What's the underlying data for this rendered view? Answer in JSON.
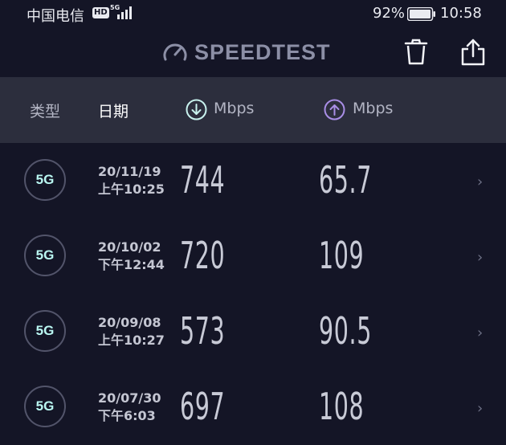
{
  "status_bar": {
    "carrier": "中国电信",
    "hd": "HD",
    "network": "5G",
    "battery": "92%",
    "time": "10:58"
  },
  "header": {
    "title": "SPEEDTEST",
    "icons": [
      "speedometer-icon",
      "trash-icon",
      "share-icon"
    ]
  },
  "columns": {
    "type": "类型",
    "date": "日期",
    "download_unit": "Mbps",
    "upload_unit": "Mbps",
    "download_color": "#c8f2ee",
    "upload_color": "#a98ee6"
  },
  "results": [
    {
      "type": "5G",
      "date": "20/11/19",
      "time": "上午10:25",
      "download": "744",
      "upload": "65.7"
    },
    {
      "type": "5G",
      "date": "20/10/02",
      "time": "下午12:44",
      "download": "720",
      "upload": "109"
    },
    {
      "type": "5G",
      "date": "20/09/08",
      "time": "上午10:27",
      "download": "573",
      "upload": "90.5"
    },
    {
      "type": "5G",
      "date": "20/07/30",
      "time": "下午6:03",
      "download": "697",
      "upload": "108"
    }
  ]
}
